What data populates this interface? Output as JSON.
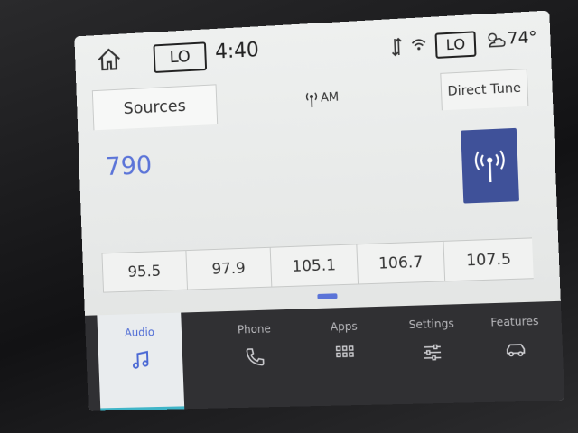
{
  "status_bar": {
    "climate_left": "LO",
    "time": "4:40",
    "climate_right": "LO",
    "temperature": "74°",
    "icons": [
      "home-icon",
      "signal-icon",
      "wifi-icon",
      "weather-icon"
    ]
  },
  "audio": {
    "sources_tab": "Sources",
    "band": "AM",
    "direct_tune_tab": "Direct Tune",
    "frequency": "790",
    "scan_icon": "radio-antenna-icon"
  },
  "presets": [
    "95.5",
    "97.9",
    "105.1",
    "106.7",
    "107.5"
  ],
  "nav": [
    {
      "label": "Audio",
      "icon": "music-note-icon",
      "active": true
    },
    {
      "label": "Phone",
      "icon": "phone-icon",
      "active": false
    },
    {
      "label": "Apps",
      "icon": "apps-grid-icon",
      "active": false
    },
    {
      "label": "Settings",
      "icon": "sliders-icon",
      "active": false
    },
    {
      "label": "Features",
      "icon": "car-icon",
      "active": false
    }
  ],
  "colors": {
    "accent": "#5b74d8",
    "tile": "#3f5199",
    "nav_bg": "#303033",
    "active_underline": "#3fb5c8"
  }
}
